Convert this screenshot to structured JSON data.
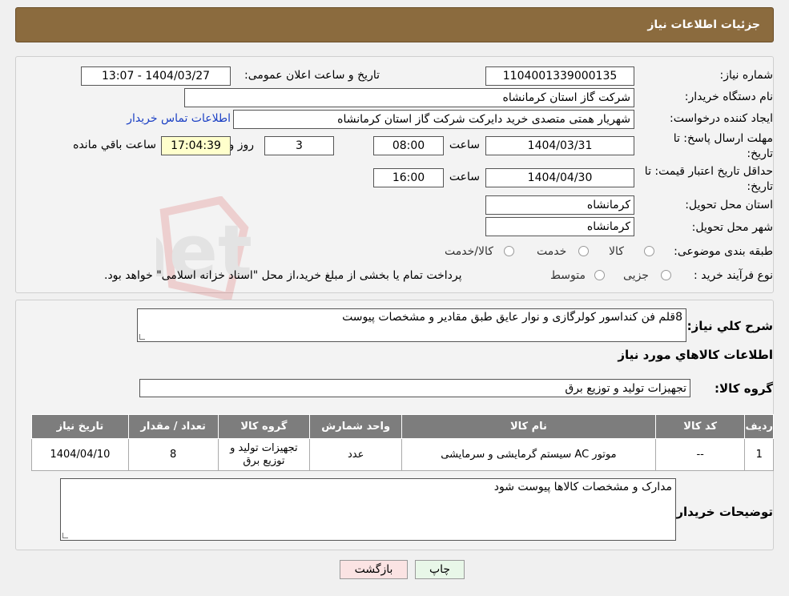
{
  "header": {
    "title": "جزئیات اطلاعات نیاز"
  },
  "form": {
    "need_number_label": "شماره نیاز:",
    "need_number": "1104001339000135",
    "announce_label": "تاریخ و ساعت اعلان عمومی:",
    "announce_value": "1404/03/27 - 13:07",
    "buyer_org_label": "نام دستگاه خریدار:",
    "buyer_org": "شرکت گاز استان کرمانشاه",
    "creator_label": "ایجاد کننده درخواست:",
    "creator": "شهریار همتی متصدی خرید دایرکت شرکت گاز استان کرمانشاه",
    "contact_link": "اطلاعات تماس خریدار",
    "deadline_label": "مهلت ارسال پاسخ: تا تاریخ:",
    "deadline_date": "1404/03/31",
    "time_label": "ساعت",
    "deadline_time": "08:00",
    "days_value": "3",
    "days_label": "روز و",
    "remaining_time": "17:04:39",
    "remaining_label": "ساعت باقي مانده",
    "validity_label": "حداقل تاریخ اعتبار قیمت: تا تاریخ:",
    "validity_date": "1404/04/30",
    "validity_time": "16:00",
    "province_label": "استان محل تحویل:",
    "province": "کرمانشاه",
    "city_label": "شهر محل تحویل:",
    "city": "کرمانشاه",
    "category_label": "طبقه بندی موضوعی:",
    "category_options": [
      "کالا",
      "خدمت",
      "کالا/خدمت"
    ],
    "purchase_type_label": "نوع فرآیند خرید :",
    "purchase_options": [
      "جزیی",
      "متوسط"
    ],
    "purchase_note": "پرداخت تمام یا بخشی از مبلغ خرید،از محل \"اسناد خزانه اسلامی\" خواهد بود."
  },
  "description": {
    "label": "شرح کلي نياز:",
    "value": "8قلم فن کنداسور کولرگازی و نوار عایق طبق مقادیر و مشخصات پیوست"
  },
  "goods_info_title": "اطلاعات کالاهاي مورد نياز",
  "goods_group": {
    "label": "گروه کالا:",
    "value": "تجهیزات تولید و توزیع برق"
  },
  "table": {
    "headers": [
      "رديف",
      "کد کالا",
      "نام کالا",
      "واحد شمارش",
      "گروه کالا",
      "تعداد / مقدار",
      "تاريخ نياز"
    ],
    "rows": [
      [
        "1",
        "--",
        "موتور AC سیستم گرمایشی و سرمایشی",
        "عدد",
        "تجهیزات تولید و توزیع برق",
        "8",
        "1404/04/10"
      ]
    ]
  },
  "buyer_notes": {
    "label": "توضيحات خريدار:",
    "value": "مدارک و مشخصات کالاها پیوست شود"
  },
  "buttons": {
    "print": "چاپ",
    "back": "بازگشت"
  },
  "colors": {
    "header_bg": "#8b6b3e",
    "table_header_bg": "#7d7d7d",
    "link": "#1a3fc4"
  }
}
